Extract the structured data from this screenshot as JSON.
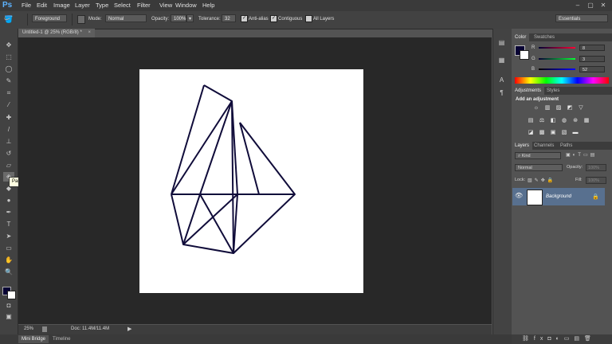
{
  "app": {
    "logo": "Ps"
  },
  "menu": [
    "File",
    "Edit",
    "Image",
    "Layer",
    "Type",
    "Select",
    "Filter",
    "View",
    "Window",
    "Help"
  ],
  "window_controls": [
    "–",
    "▢",
    "✕"
  ],
  "options": {
    "fill_source": "Foreground",
    "mode_label": "Mode:",
    "mode_value": "Normal",
    "opacity_label": "Opacity:",
    "opacity_value": "100%",
    "tolerance_label": "Tolerance:",
    "tolerance_value": "32",
    "anti_alias": "Anti-alias",
    "contiguous": "Contiguous",
    "all_layers": "All Layers",
    "workspace": "Essentials"
  },
  "document": {
    "tab_title": "Untitled-1 @ 25% (RGB/8) *",
    "zoom": "25%",
    "doc_size": "Doc: 11.4M/11.4M"
  },
  "tooltip": "Paint Bucket Tool (G)",
  "bottom_tabs": [
    "Mini Bridge",
    "Timeline"
  ],
  "color_panel": {
    "tabs": [
      "Color",
      "Swatches"
    ],
    "r_label": "R",
    "r_value": "8",
    "g_label": "G",
    "g_value": "3",
    "b_label": "B",
    "b_value": "52",
    "foreground_color": "#080334",
    "background_color": "#ffffff"
  },
  "adjustments_panel": {
    "tabs": [
      "Adjustments",
      "Styles"
    ],
    "heading": "Add an adjustment"
  },
  "layers_panel": {
    "tabs": [
      "Layers",
      "Channels",
      "Paths"
    ],
    "filter_label": "Kind",
    "blend_mode": "Normal",
    "opacity_label": "Opacity:",
    "opacity_value": "100%",
    "lock_label": "Lock:",
    "fill_label": "Fill:",
    "fill_value": "100%",
    "layer_name": "Background"
  }
}
